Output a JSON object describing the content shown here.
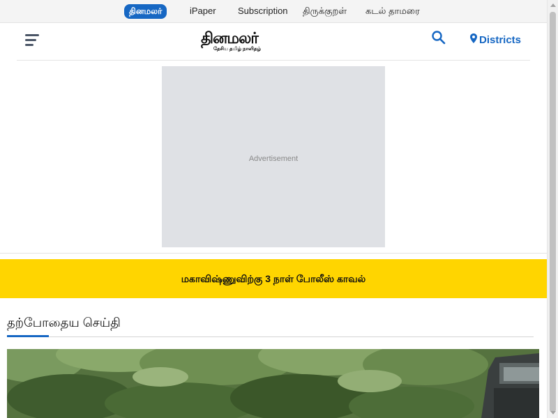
{
  "topbar": {
    "brand_label": "தினமலர்",
    "links": [
      "iPaper",
      "Subscription",
      "திருக்குறள்",
      "கடல் தாமரை"
    ]
  },
  "header": {
    "logo_text": "தினமலர்",
    "logo_subtext": "தேசிய தமிழ் நாளிதழ்",
    "districts_label": "Districts",
    "icons": [
      "hamburger-menu-icon",
      "search-icon",
      "location-pin-icon"
    ]
  },
  "ad": {
    "label": "Advertisement"
  },
  "breaking": {
    "text": "மகாவிஷ்ணுவிற்கு 3 நாள் போலீஸ் காவல்"
  },
  "section": {
    "title": "தற்போதைய செய்தி"
  },
  "colors": {
    "accent_blue": "#1667c3",
    "banner_yellow": "#ffd500",
    "ad_gray": "#dfe1e5"
  }
}
